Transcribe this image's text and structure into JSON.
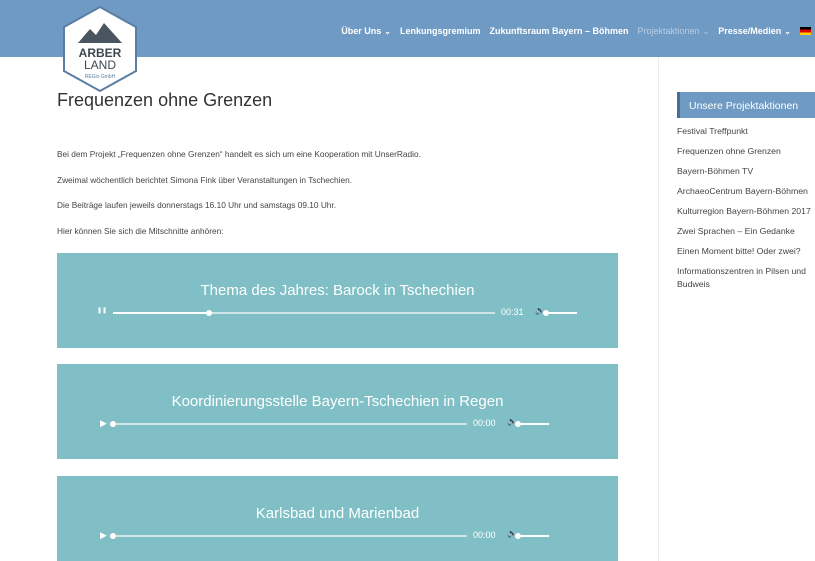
{
  "logo": {
    "line1": "ARBER",
    "line2": "LAND",
    "line3": "REGio GmbH"
  },
  "nav": {
    "items": [
      {
        "label": "Über Uns",
        "chevron": true
      },
      {
        "label": "Lenkungsgremium",
        "chevron": false
      },
      {
        "label": "Zukunftsraum Bayern – Böhmen",
        "chevron": false
      },
      {
        "label": "Projektaktionen",
        "chevron": true,
        "active": true
      },
      {
        "label": "Presse/Medien",
        "chevron": true
      }
    ],
    "language_flag": "german-flag-icon"
  },
  "page": {
    "title": "Frequenzen ohne Grenzen",
    "paragraphs": [
      "Bei dem Projekt „Frequenzen ohne Grenzen“ handelt es sich um eine Kooperation mit UnserRadio.",
      "Zweimal wöchentlich berichtet Simona Fink über Veranstaltungen in Tschechien.",
      "Die Beiträge laufen jeweils donnerstags 16.10 Uhr und samstags 09.10 Uhr.",
      "Hier können Sie sich die Mitschnitte anhören:"
    ]
  },
  "players": [
    {
      "title": "Thema des Jahres: Barock in Tschechien",
      "state": "playing",
      "time": "00:31",
      "progress": 0.25
    },
    {
      "title": "Koordinierungsstelle Bayern-Tschechien in Regen",
      "state": "paused",
      "time": "00:00",
      "progress": 0
    },
    {
      "title": "Karlsbad und Marienbad",
      "state": "paused",
      "time": "00:00",
      "progress": 0
    }
  ],
  "sidebar": {
    "heading": "Unsere Projektaktionen",
    "items": [
      "Festival Treffpunkt",
      "Frequenzen ohne Grenzen",
      "Bayern-Böhmen TV",
      "ArchaeoCentrum Bayern-Böhmen",
      "Kulturregion Bayern-Böhmen 2017",
      "Zwei Sprachen – Ein Gedanke",
      "Einen Moment bitte! Oder zwei?",
      "Informationszentren in Pilsen und Budweis"
    ]
  },
  "colors": {
    "header": "#6f9ac4",
    "player": "#7fbfc5",
    "sidebar_head": "#6f9ac4"
  }
}
